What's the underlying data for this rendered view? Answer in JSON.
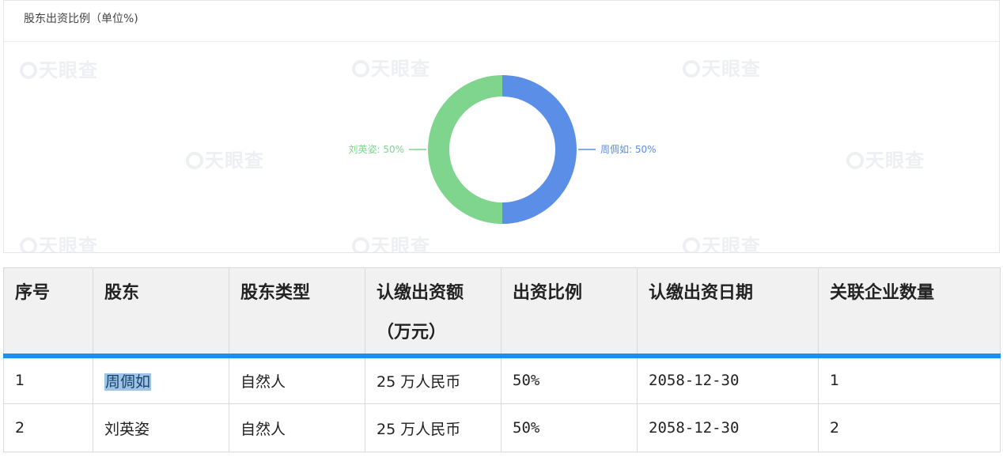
{
  "panel": {
    "title": "股东出资比例（单位%)",
    "watermark_text": "天眼查"
  },
  "chart_data": {
    "type": "pie",
    "title": "股东出资比例（单位%)",
    "series": [
      {
        "name": "周倜如",
        "value": 50,
        "label": "周倜如: 50%",
        "color": "#5b8ee6"
      },
      {
        "name": "刘英姿",
        "value": 50,
        "label": "刘英姿: 50%",
        "color": "#7fd58d"
      }
    ]
  },
  "table": {
    "headers": [
      "序号",
      "股东",
      "股东类型",
      "认缴出资额",
      "出资比例",
      "认缴出资日期",
      "关联企业数量"
    ],
    "header_sub3": "（万元）",
    "rows": [
      {
        "index": "1",
        "holder": "周倜如",
        "type": "自然人",
        "amount": "25 万人民币",
        "ratio": "50%",
        "date": "2058-12-30",
        "related": "1"
      },
      {
        "index": "2",
        "holder": "刘英姿",
        "type": "自然人",
        "amount": "25 万人民币",
        "ratio": "50%",
        "date": "2058-12-30",
        "related": "2"
      }
    ]
  },
  "colors": {
    "accent": "#1890f0",
    "series_blue": "#5b8ee6",
    "series_green": "#7fd58d"
  }
}
